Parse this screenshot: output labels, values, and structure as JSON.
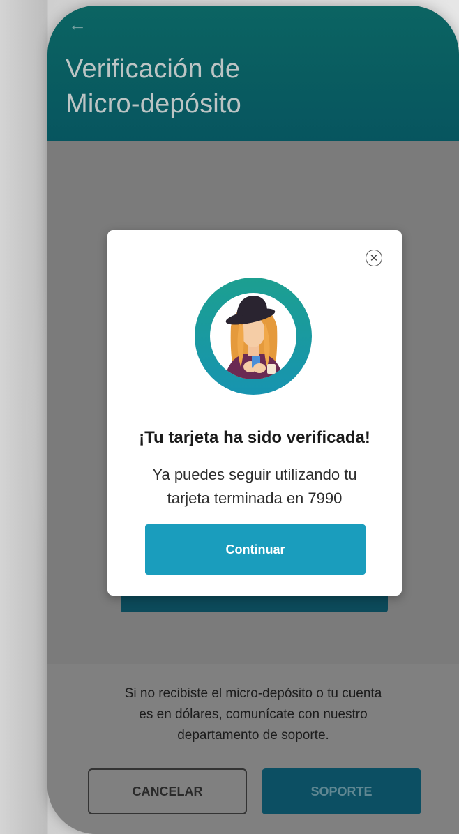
{
  "header": {
    "back_icon": "arrow-left-icon",
    "title_line1": "Verificación de",
    "title_line2": "Micro-depósito"
  },
  "modal": {
    "close_icon": "close-circle-icon",
    "illustration": "woman-holding-card-illustration",
    "title": "¡Tu tarjeta ha sido verificada!",
    "message_line1": "Ya puedes seguir utilizando tu",
    "message_line2": "tarjeta terminada en 7990",
    "continue_label": "Continuar"
  },
  "footer": {
    "support_line1": "Si no recibiste el micro-depósito o tu cuenta",
    "support_line2": "es en dólares, comunícate con nuestro",
    "support_line3": "departamento de soporte.",
    "cancel_label": "CANCELAR",
    "support_label": "SOPORTE"
  },
  "colors": {
    "header": "#07555f",
    "accent": "#1a9dbd",
    "overlay": "#7b7b7b",
    "support_button": "#0c4f63"
  }
}
